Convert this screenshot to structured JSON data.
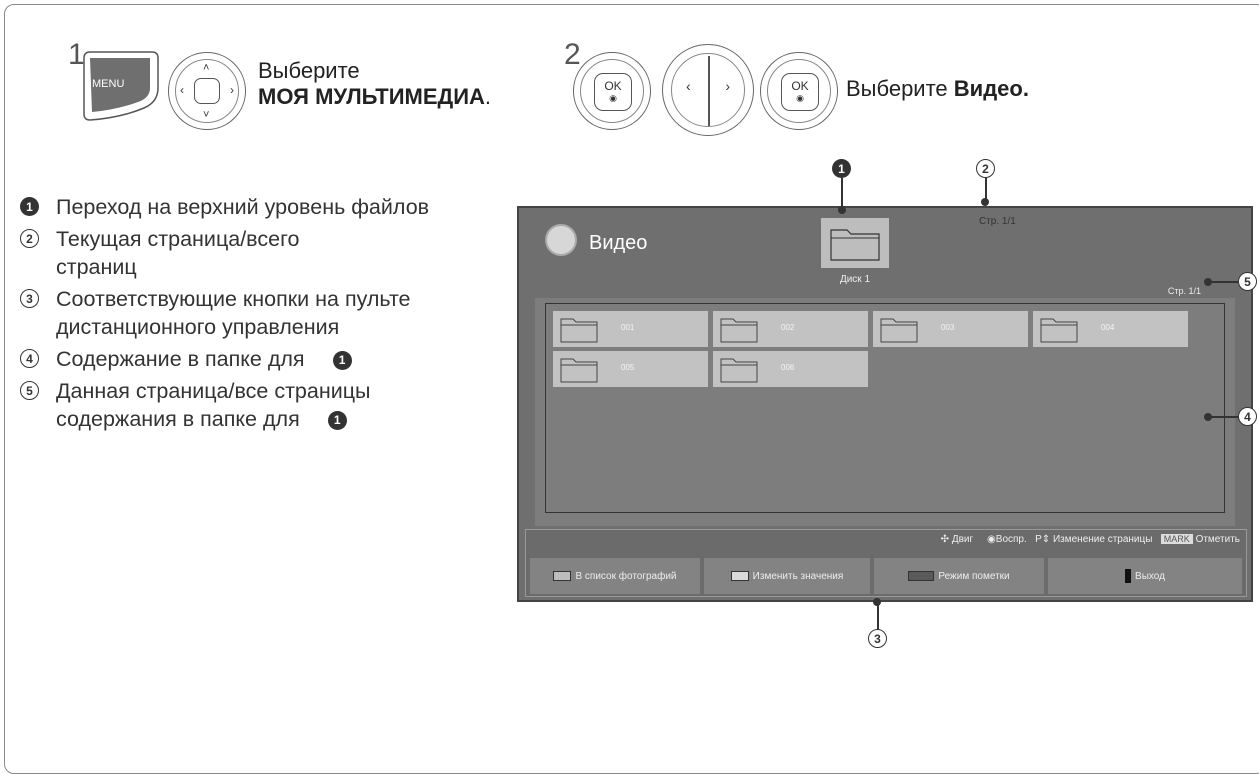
{
  "steps": {
    "step1_number": "1",
    "step1_menu_label": "MENU",
    "step1_text_line1": "Выберите",
    "step1_text_line2": "МОЯ МУЛЬТИМЕДИА",
    "step1_text_suffix": ".",
    "step2_number": "2",
    "ok_label": "OK",
    "ok_dot": "◉",
    "step2_text": "Выберите ",
    "step2_text_bold": "Видео."
  },
  "legend": {
    "items": [
      {
        "num": "1",
        "text": "Переход на верхний уровень файлов"
      },
      {
        "num": "2",
        "text": "Текущая страница/всего страниц"
      },
      {
        "num": "3",
        "text": "Соответствующие кнопки на пульте дистанционного управления"
      },
      {
        "num": "4",
        "text": "Содержание в папке для"
      },
      {
        "num": "5",
        "text": "Данная страница/все страницы содержания в папке для"
      }
    ],
    "ref_num": "1"
  },
  "screen": {
    "title": "Видео",
    "drive_label": "Диск 1",
    "page_top": "Стр. 1/1",
    "page_right": "Стр. 1/1",
    "folders": [
      "001",
      "002",
      "003",
      "004",
      "005",
      "006"
    ],
    "nav": {
      "move": "Двиг",
      "play": "Воспр.",
      "page_change": "Изменение страницы",
      "mark_key": "MARK",
      "mark_label": "Отметить"
    },
    "buttons": [
      {
        "label": "В список фотографий",
        "color": "#bdbdbd"
      },
      {
        "label": "Изменить значения",
        "color": "#d9d9d9"
      },
      {
        "label": "Режим пометки",
        "color": "#5a5a5a"
      },
      {
        "label": "Выход",
        "color": "#111111"
      }
    ]
  },
  "callouts": [
    "1",
    "2",
    "3",
    "4",
    "5"
  ],
  "colors": {
    "screen_bg": "#6f6f6f",
    "folder_tile": "#c2c2c2",
    "ink": "#333333"
  }
}
